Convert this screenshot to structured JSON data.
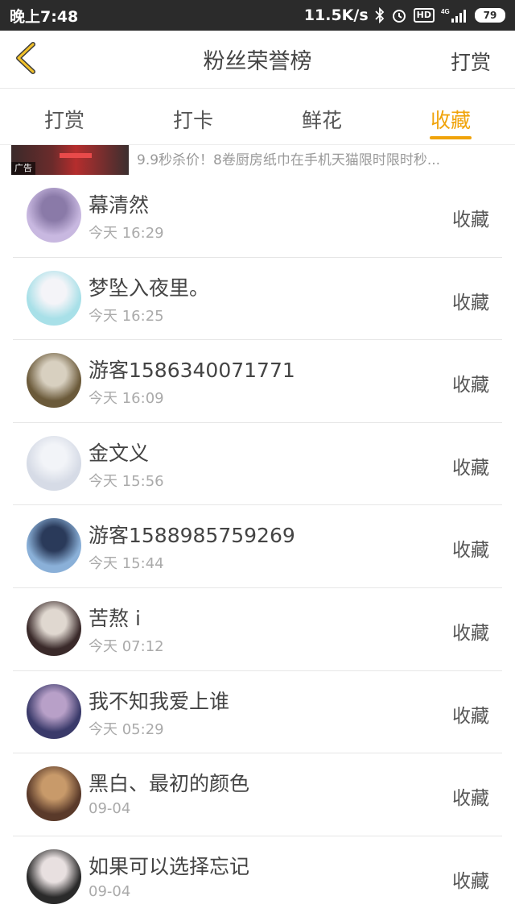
{
  "status_bar": {
    "time": "晚上7:48",
    "speed": "11.5K/s",
    "network": "4G",
    "battery": "79",
    "icons": [
      "bluetooth-icon",
      "alarm-icon",
      "hd-icon",
      "signal-icon",
      "battery-icon"
    ],
    "hd_label": "HD"
  },
  "header": {
    "title": "粉丝荣誉榜",
    "right_action": "打赏",
    "back_icon": "chevron-left-icon",
    "accent_color": "#f0c02a"
  },
  "tabs": [
    {
      "label": "打赏",
      "active": false
    },
    {
      "label": "打卡",
      "active": false
    },
    {
      "label": "鲜花",
      "active": false
    },
    {
      "label": "收藏",
      "active": true
    }
  ],
  "ad": {
    "badge": "广告",
    "text": "9.9秒杀价！8卷厨房纸巾在手机天猫限时限时秒..."
  },
  "fans": [
    {
      "name": "幕清然",
      "time": "今天 16:29",
      "action": "收藏",
      "avatar_colors": [
        "#c8b8e0",
        "#8a7aa8"
      ]
    },
    {
      "name": "梦坠入夜里。",
      "time": "今天 16:25",
      "action": "收藏",
      "avatar_colors": [
        "#a8e0e8",
        "#f4f4f8"
      ]
    },
    {
      "name": "游客1586340071771",
      "time": "今天 16:09",
      "action": "收藏",
      "avatar_colors": [
        "#6b5a3a",
        "#d8d0c0"
      ]
    },
    {
      "name": "金文义",
      "time": "今天 15:56",
      "action": "收藏",
      "avatar_colors": [
        "#d6dbe6",
        "#f2f4f8"
      ]
    },
    {
      "name": "游客1588985759269",
      "time": "今天 15:44",
      "action": "收藏",
      "avatar_colors": [
        "#8ab0d8",
        "#2a3a5a"
      ]
    },
    {
      "name": "苦熬 i",
      "time": "今天 07:12",
      "action": "收藏",
      "avatar_colors": [
        "#3a2a2a",
        "#e0d8d0"
      ]
    },
    {
      "name": "我不知我爱上谁",
      "time": "今天 05:29",
      "action": "收藏",
      "avatar_colors": [
        "#3a3a6a",
        "#b8a0c8"
      ]
    },
    {
      "name": "黑白、最初的颜色",
      "time": "09-04",
      "action": "收藏",
      "avatar_colors": [
        "#5a3a2a",
        "#c89a6a"
      ]
    },
    {
      "name": "如果可以选择忘记",
      "time": "09-04",
      "action": "收藏",
      "avatar_colors": [
        "#2a2a2a",
        "#e8e0e0"
      ]
    }
  ]
}
